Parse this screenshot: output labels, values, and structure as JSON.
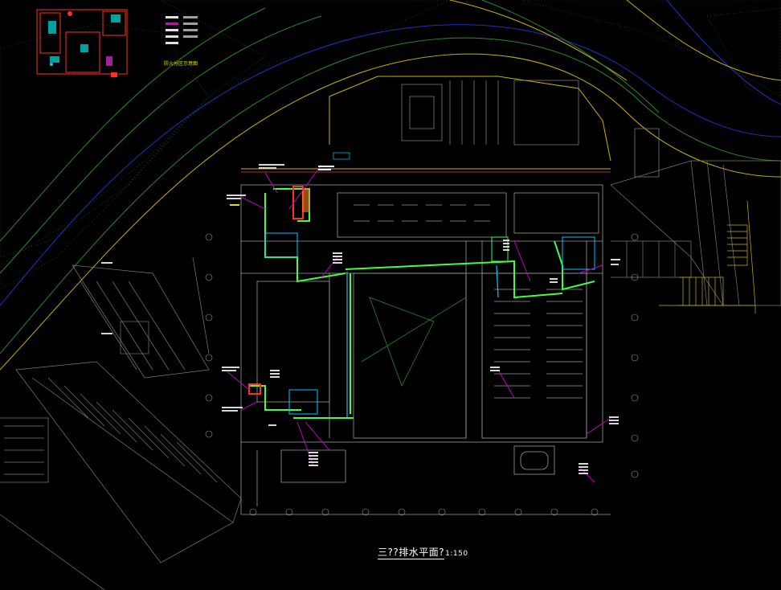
{
  "drawing": {
    "title": "三??排水平面?",
    "scale": "1:150",
    "keyplan_title": "防火分区示意图"
  },
  "colors": {
    "background": "#000000",
    "road_yellow": "#c8b400",
    "road_green": "#2a8a2a",
    "boundary_blue": "#2030c0",
    "wall_gray": "#9a9a9a",
    "pipe_green": "#40ff40",
    "pipe_cyan": "#00c8ff",
    "leader_magenta": "#c000c0",
    "fixture_red": "#ff3020",
    "accent_yellow": "#ffff00"
  }
}
